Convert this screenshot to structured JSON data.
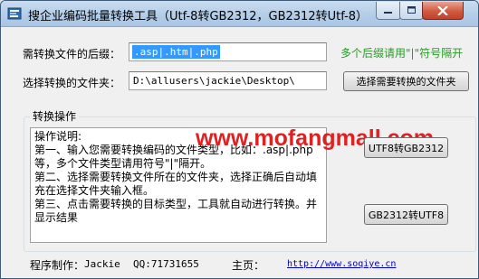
{
  "window": {
    "title": "搜企业编码批量转换工具（Utf-8转GB2312，GB2312转Utf-8）",
    "controls": {
      "minimize": "—",
      "maximize": "□",
      "close": "✕"
    }
  },
  "form": {
    "suffix_label": "需转换文件的后缀：",
    "suffix_value": ".asp|.htm|.php",
    "suffix_hint": "多个后缀请用\"|\"符号隔开",
    "folder_label": "选择转换的文件夹：",
    "folder_value": "D:\\allusers\\jackie\\Desktop\\",
    "folder_button": "选择需要转换的文件夹"
  },
  "group": {
    "title": "转换操作",
    "instructions": [
      "操作说明:",
      "第一、输入您需要转换编码的文件类型，比如：.asp|.php等，多个文件类型请用符号\"|\"隔开。",
      "第二、选择需要转换文件所在的文件夹，选择正确后自动填充在选择文件夹输入框。",
      "第三、点击需要转换的目标类型，工具就自动进行转换。并显示结果"
    ],
    "btn_utf8_to_gb": "UTF8转GB2312",
    "btn_gb_to_utf8": "GB2312转UTF8"
  },
  "watermark": "www.mofangmall.com",
  "footer": {
    "author_label": "程序制作：",
    "author_name": "Jackie",
    "qq": "QQ:71731655",
    "home_label": "主页：",
    "home_url": "http://www.soqiye.cn"
  },
  "colors": {
    "hint_green": "#2a9a2a",
    "watermark_red": "#e12020",
    "selection_blue": "#3399ff",
    "link_blue": "#0000cc"
  }
}
